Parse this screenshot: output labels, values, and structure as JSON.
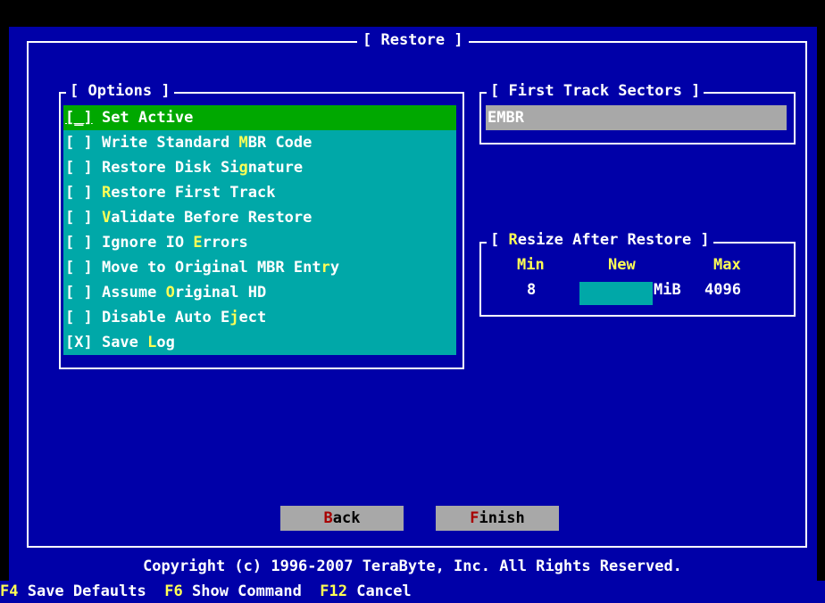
{
  "window": {
    "title": "[ Restore ]"
  },
  "options": {
    "title": "[ Options ]",
    "items": [
      {
        "box": "[_]",
        "pre": " Set Active",
        "hk": "",
        "post": "",
        "checked": false
      },
      {
        "box": "[ ]",
        "pre": " Write Standard ",
        "hk": "M",
        "post": "BR Code",
        "checked": false
      },
      {
        "box": "[ ]",
        "pre": " Restore Disk Si",
        "hk": "g",
        "post": "nature",
        "checked": false
      },
      {
        "box": "[ ]",
        "pre": " ",
        "hk": "R",
        "post": "estore First Track",
        "checked": false
      },
      {
        "box": "[ ]",
        "pre": " ",
        "hk": "V",
        "post": "alidate Before Restore",
        "checked": false
      },
      {
        "box": "[ ]",
        "pre": " Ignore IO ",
        "hk": "E",
        "post": "rrors",
        "checked": false
      },
      {
        "box": "[ ]",
        "pre": " Move to Original MBR Ent",
        "hk": "r",
        "post": "y",
        "checked": false
      },
      {
        "box": "[ ]",
        "pre": " Assume ",
        "hk": "O",
        "post": "riginal HD",
        "checked": false
      },
      {
        "box": "[ ]",
        "pre": " Disable Auto E",
        "hk": "j",
        "post": "ect",
        "checked": false
      },
      {
        "box": "[X]",
        "pre": " Save ",
        "hk": "L",
        "post": "og",
        "checked": true
      }
    ]
  },
  "first_track": {
    "title": "[ First Track Sectors ]",
    "value": "EMBR"
  },
  "resize": {
    "title_open": "[ ",
    "title_hk": "R",
    "title_rest": "esize After Restore ]",
    "min_label": "Min",
    "new_label": "New",
    "max_label": "Max",
    "min_value": "8",
    "new_value": "",
    "unit": "MiB",
    "max_value": "4096"
  },
  "buttons": {
    "back": {
      "hk": "B",
      "rest": "ack"
    },
    "finish": {
      "hk": "F",
      "rest": "inish"
    }
  },
  "copyright": "Copyright (c) 1996-2007 TeraByte, Inc.  All Rights Reserved.",
  "statusbar": [
    {
      "key": "F4",
      "label": " Save Defaults"
    },
    {
      "key": "F6",
      "label": " Show Command"
    },
    {
      "key": "F12",
      "label": " Cancel"
    }
  ],
  "colors": {
    "background": "#0000a8",
    "option_bg": "#00a8a8",
    "focus_bg": "#00a800",
    "hotkey": "#ffff54",
    "button_bg": "#a8a8a8",
    "button_hotkey": "#a80000"
  }
}
